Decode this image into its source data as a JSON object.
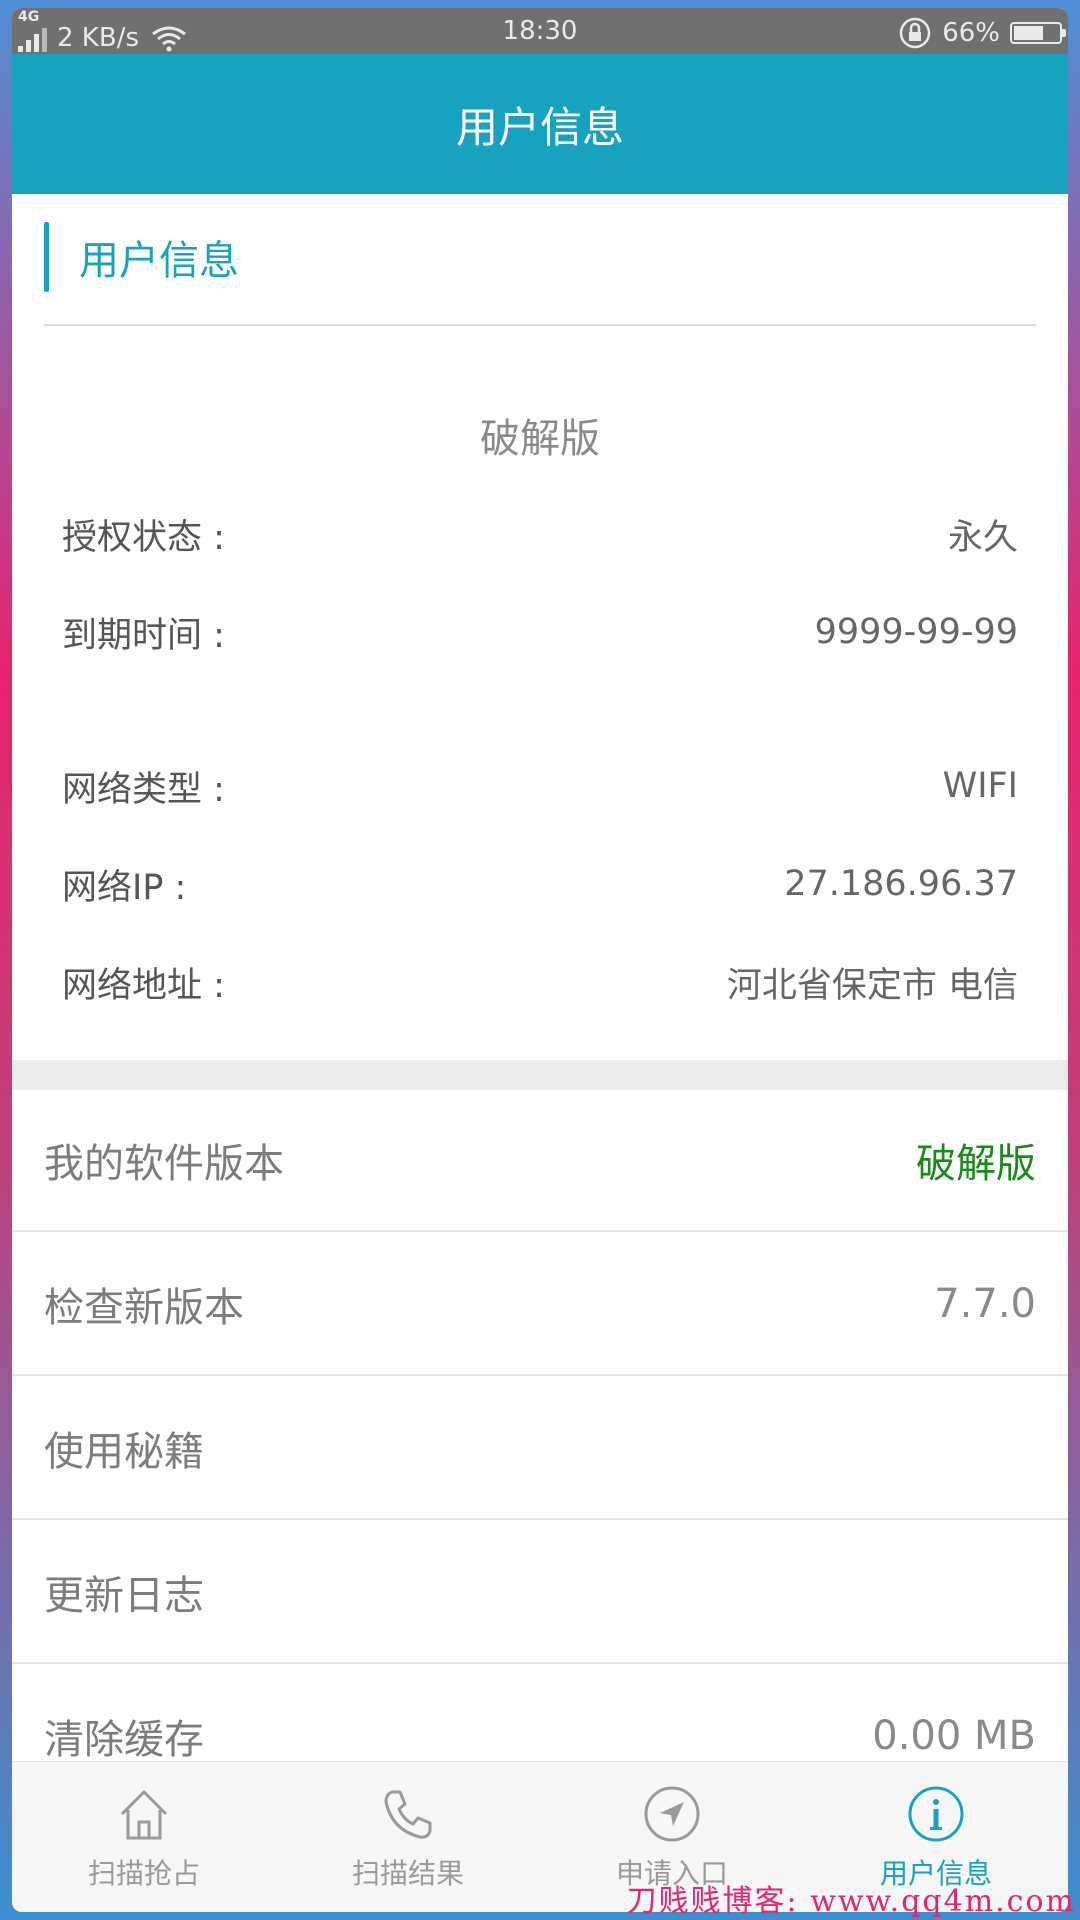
{
  "status_bar": {
    "network_type": "4G",
    "speed": "2 KB/s",
    "time": "18:30",
    "battery_percent": "66%",
    "battery_level": 0.66,
    "icons": [
      "signal-icon",
      "wifi-icon",
      "rotation-lock-icon",
      "battery-icon"
    ]
  },
  "header": {
    "title": "用户信息"
  },
  "section": {
    "title": "用户信息"
  },
  "user_info": {
    "edition": "破解版",
    "rows": [
      {
        "label": "授权状态 :",
        "value": "永久"
      },
      {
        "label": "到期时间 :",
        "value": "9999-99-99"
      },
      {
        "label": "网络类型 :",
        "value": "WIFI"
      },
      {
        "label": "网络IP :",
        "value": "27.186.96.37"
      },
      {
        "label": "网络地址 :",
        "value": "河北省保定市 电信"
      }
    ]
  },
  "settings": [
    {
      "label": "我的软件版本",
      "value": "破解版"
    },
    {
      "label": "检查新版本",
      "value": "7.7.0"
    },
    {
      "label": "使用秘籍",
      "value": ""
    },
    {
      "label": "更新日志",
      "value": ""
    },
    {
      "label": "清除缓存",
      "value": "0.00 MB"
    }
  ],
  "tabs": [
    {
      "label": "扫描抢占",
      "icon": "home-icon"
    },
    {
      "label": "扫描结果",
      "icon": "phone-icon"
    },
    {
      "label": "申请入口",
      "icon": "navigation-icon"
    },
    {
      "label": "用户信息",
      "icon": "info-icon",
      "active": true
    }
  ],
  "colors": {
    "accent": "#17a2bf",
    "value_green": "#1a8a1a"
  },
  "watermark": "刀贱贱博客: www.qq4m.com"
}
